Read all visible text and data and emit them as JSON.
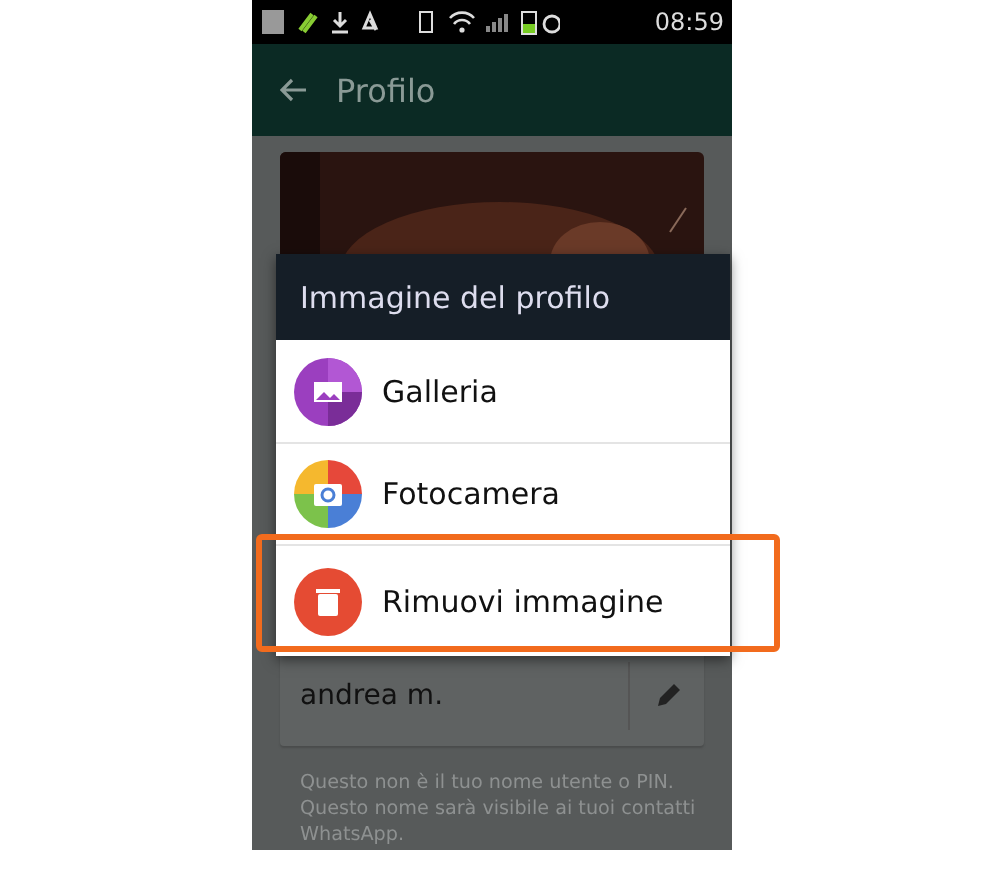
{
  "status_bar": {
    "time": "08:59"
  },
  "app_bar": {
    "title": "Profilo"
  },
  "dialog": {
    "title": "Immagine del profilo",
    "options": [
      {
        "kind": "gallery",
        "label": "Galleria",
        "highlighted": false
      },
      {
        "kind": "camera",
        "label": "Fotocamera",
        "highlighted": false
      },
      {
        "kind": "remove",
        "label": "Rimuovi immagine",
        "highlighted": true
      }
    ]
  },
  "name_field": {
    "value": "andrea m."
  },
  "hint": "Questo non è il tuo nome utente o PIN. Questo nome sarà visibile ai tuoi contatti WhatsApp."
}
